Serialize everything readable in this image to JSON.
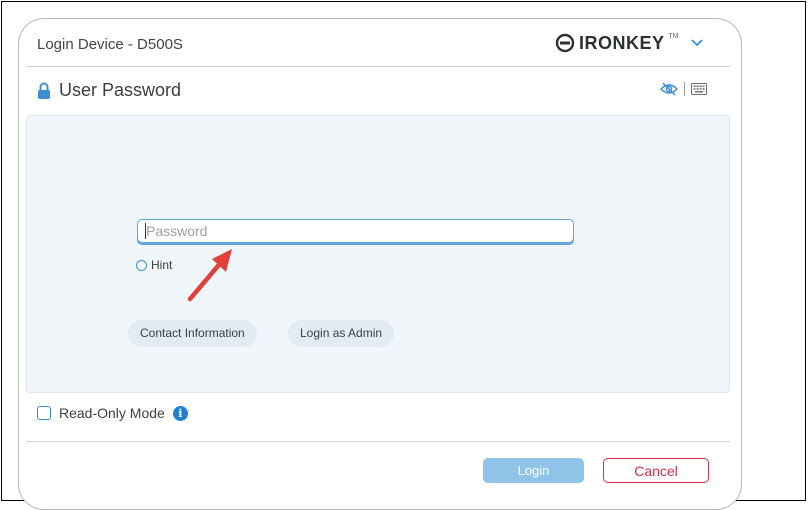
{
  "window": {
    "title": "Login Device - D500S",
    "brand": "IRONKEY",
    "brand_tm": "TM"
  },
  "section": {
    "title": "User Password"
  },
  "password_field": {
    "value": "",
    "placeholder": "Password"
  },
  "hint": {
    "label": "Hint"
  },
  "buttons": {
    "contact": "Contact Information",
    "admin": "Login as Admin",
    "login": "Login",
    "cancel": "Cancel"
  },
  "read_only": {
    "label": "Read-Only Mode",
    "checked": false
  },
  "icons": {
    "lock": "lock-icon",
    "brand_logo": "key-logo-icon",
    "dropdown": "chevron-down-icon",
    "visibility": "eye-slash-icon",
    "keyboard": "keyboard-icon",
    "info": "info-icon",
    "annotation": "red-arrow"
  },
  "colors": {
    "accent": "#3d8fd1",
    "login_button": "#8fc3e8",
    "cancel": "#d0304e",
    "panel": "#f1f6fb",
    "arrow": "#e0413a"
  }
}
